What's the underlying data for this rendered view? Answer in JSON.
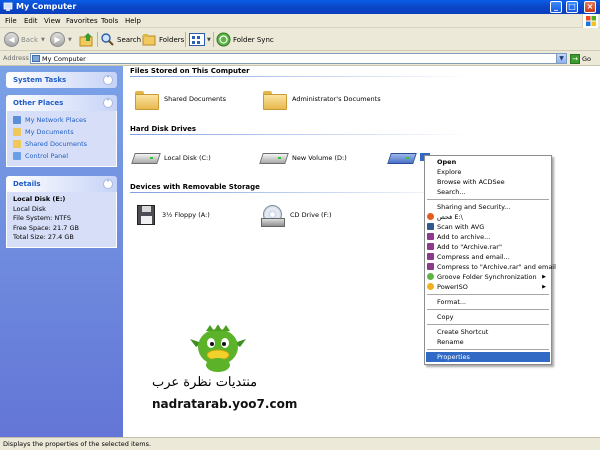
{
  "window": {
    "title": "My Computer"
  },
  "menu": [
    "File",
    "Edit",
    "View",
    "Favorites",
    "Tools",
    "Help"
  ],
  "toolbar": {
    "back": "Back",
    "search": "Search",
    "folders": "Folders",
    "folder_sync": "Folder Sync"
  },
  "address": {
    "label": "Address",
    "value": "My Computer",
    "go": "Go"
  },
  "sidebar": {
    "system_tasks": {
      "title": "System Tasks"
    },
    "other_places": {
      "title": "Other Places",
      "items": [
        "My Network Places",
        "My Documents",
        "Shared Documents",
        "Control Panel"
      ]
    },
    "details": {
      "title": "Details",
      "lines": [
        "Local Disk (E:)",
        "Local Disk",
        "File System: NTFS",
        "Free Space: 21.7 GB",
        "Total Size: 27.4 GB"
      ]
    }
  },
  "groups": {
    "files": {
      "title": "Files Stored on This Computer",
      "items": [
        "Shared Documents",
        "Administrator's Documents"
      ]
    },
    "hdd": {
      "title": "Hard Disk Drives",
      "items": [
        "Local Disk (C:)",
        "New Volume (D:)"
      ]
    },
    "removable": {
      "title": "Devices with Removable Storage",
      "items": [
        "3½ Floppy (A:)",
        "CD Drive (F:)"
      ]
    }
  },
  "context_menu": {
    "items": [
      "Open",
      "Explore",
      "Browse with ACDSee",
      "Search...",
      "Sharing and Security...",
      "فحص E:\\",
      "Scan with AVG",
      "Add to archive...",
      "Add to \"Archive.rar\"",
      "Compress and email...",
      "Compress to \"Archive.rar\" and email",
      "Groove Folder Synchronization",
      "PowerISO",
      "Format...",
      "Copy",
      "Create Shortcut",
      "Rename",
      "Properties"
    ]
  },
  "watermark": {
    "arabic": "منتديات نظرة عرب",
    "url": "nadratarab.yoo7.com"
  },
  "status": {
    "text": "Displays the properties of the selected items."
  },
  "colors": {
    "title_bar": "#0a47c9",
    "task_pane": "#6375d6",
    "selection": "#316ac5"
  }
}
